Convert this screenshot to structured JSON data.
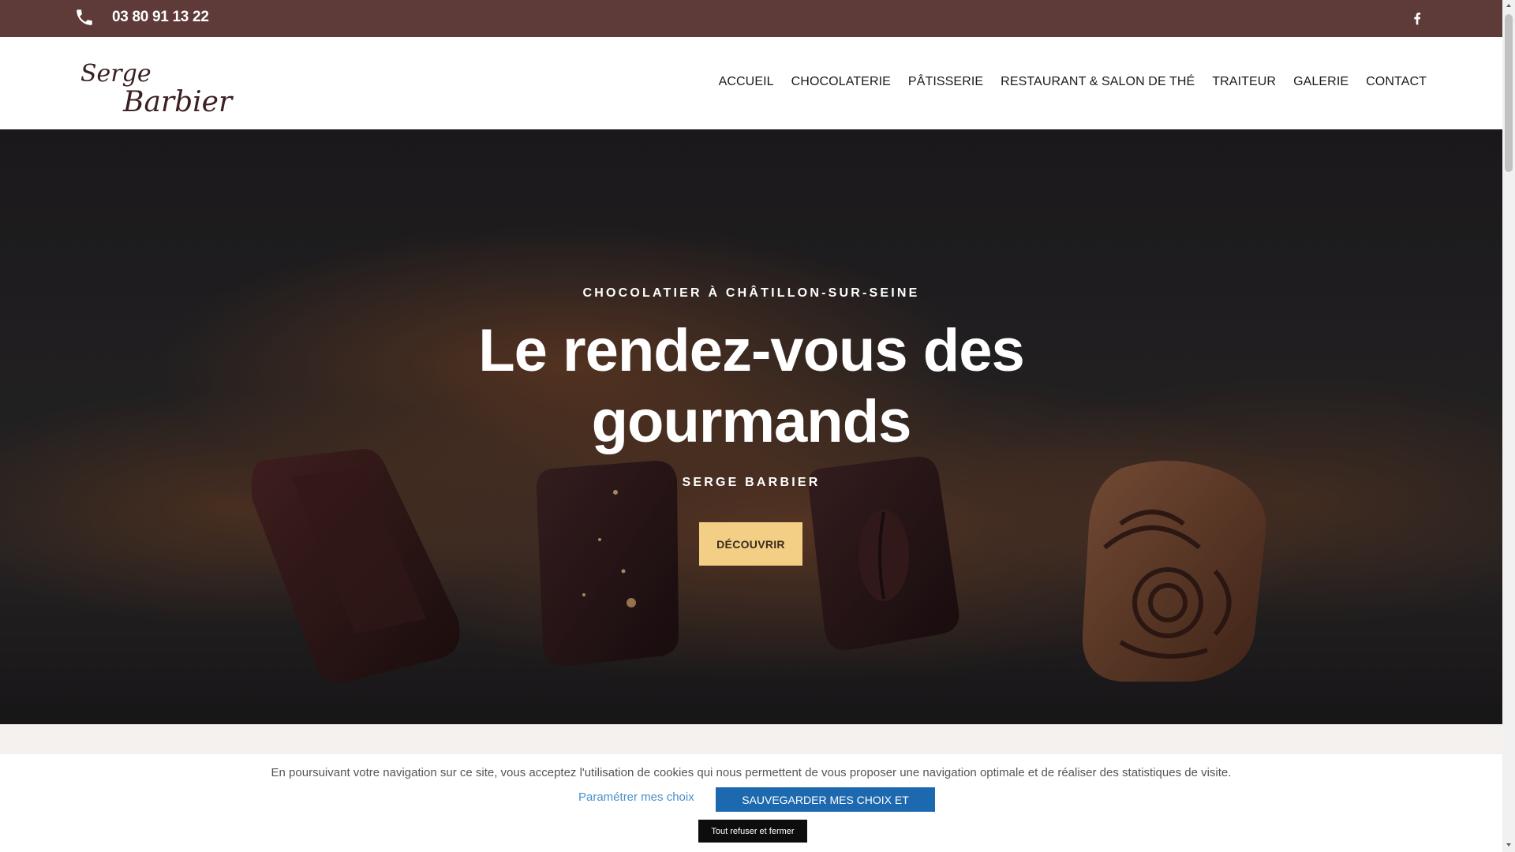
{
  "topbar": {
    "phone": "03 80 91 13 22",
    "phone_icon": "phone-icon",
    "social_icon": "facebook-icon"
  },
  "header": {
    "logo_line1": "Serge",
    "logo_line2": "Barbier",
    "nav": [
      {
        "label": "ACCUEIL"
      },
      {
        "label": "CHOCOLATERIE"
      },
      {
        "label": "PÂTISSERIE"
      },
      {
        "label": "RESTAURANT & SALON DE THÉ"
      },
      {
        "label": "TRAITEUR"
      },
      {
        "label": "GALERIE"
      },
      {
        "label": "CONTACT"
      }
    ]
  },
  "hero": {
    "kicker": "CHOCOLATIER À CHÂTILLON-SUR-SEINE",
    "title": "Le rendez-vous des gourmands",
    "subtitle": "SERGE BARBIER",
    "button": "DÉCOUVRIR"
  },
  "cookie_banner": {
    "text": "En poursuivant votre navigation sur ce site, vous acceptez l'utilisation de cookies qui nous permettent de vous proposer une navigation optimale et de réaliser des statistiques de visite.",
    "settings_link": "Paramétrer mes choix",
    "save_button": "SAUVEGARDER MES CHOIX ET FERMER",
    "refuse_button": "Tout refuser et fermer"
  },
  "colors": {
    "topbar": "#5e3a38",
    "button_gold": "#f2cf85",
    "save_blue": "#1d69b0"
  }
}
